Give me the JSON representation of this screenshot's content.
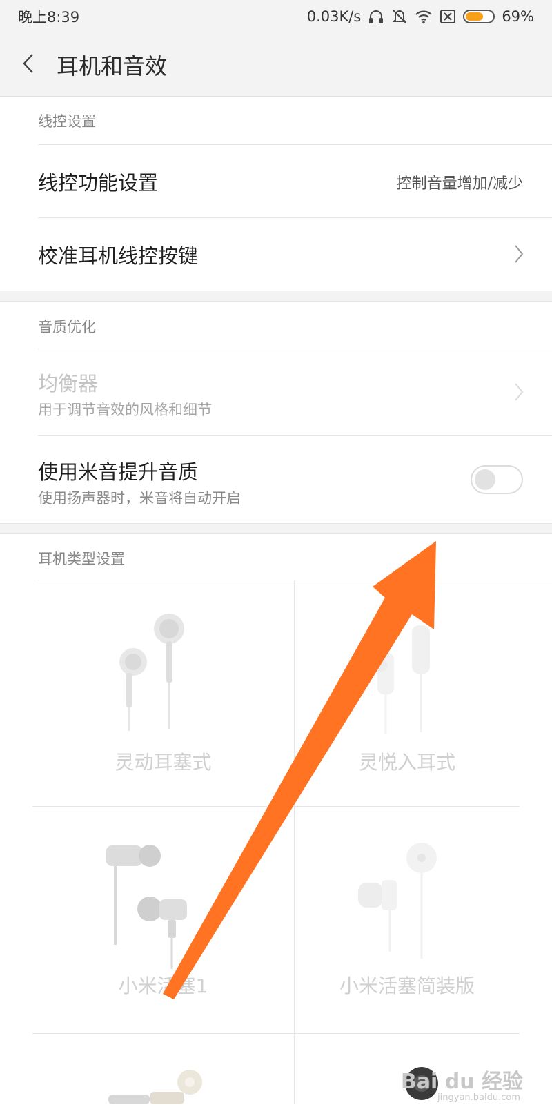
{
  "status_bar": {
    "time": "晚上8:39",
    "network_speed": "0.03K/s",
    "battery_percent": "69%",
    "battery_level": 0.69,
    "icons": [
      "headphones-icon",
      "bell-off-icon",
      "wifi-icon",
      "sim-off-icon",
      "battery-icon"
    ]
  },
  "header": {
    "title": "耳机和音效"
  },
  "wire_control": {
    "section_label": "线控设置",
    "function_label": "线控功能设置",
    "function_value": "控制音量增加/减少",
    "calibrate_label": "校准耳机线控按键"
  },
  "sound_quality": {
    "section_label": "音质优化",
    "equalizer_label": "均衡器",
    "equalizer_desc": "用于调节音效的风格和细节",
    "mi_sound_label": "使用米音提升音质",
    "mi_sound_desc": "使用扬声器时，米音将自动开启",
    "mi_sound_enabled": false
  },
  "headphone_type": {
    "section_label": "耳机类型设置",
    "items": [
      {
        "label": "灵动耳塞式"
      },
      {
        "label": "灵悦入耳式"
      },
      {
        "label": "小米活塞1"
      },
      {
        "label": "小米活塞简装版"
      }
    ]
  },
  "watermark": {
    "text": "Bai du 经验",
    "url": "jingyan.baidu.com"
  },
  "colors": {
    "accent_arrow": "#ff7322",
    "battery_fill": "#f7a11a",
    "background_gray": "#f3f3f3"
  }
}
